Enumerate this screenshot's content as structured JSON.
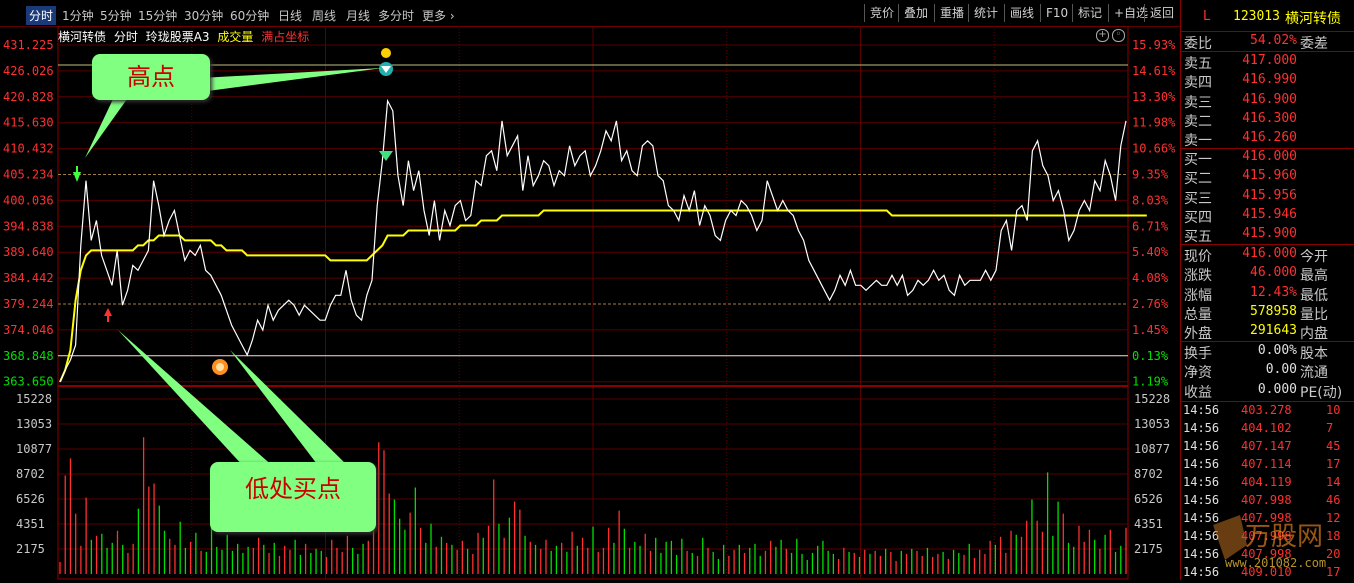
{
  "toolbar": {
    "tabs": [
      "分时",
      "1分钟",
      "5分钟",
      "15分钟",
      "30分钟",
      "60分钟",
      "日线",
      "周线",
      "月线",
      "多分时",
      "更多"
    ],
    "buttons": [
      "竞价",
      "叠加",
      "重播",
      "统计",
      "画线",
      "F10",
      "标记",
      "+自选",
      "返回"
    ]
  },
  "chart": {
    "name": "横河转债",
    "mode": "分时",
    "indicator": "玲珑股票A3",
    "volume_label": "成交量",
    "coord_label": "满占坐标"
  },
  "colors": {
    "up": "#ff3030",
    "down": "#00e000",
    "price_line": "#ffffff",
    "avg_line": "#ffff00",
    "grid": "#5a0000"
  },
  "chart_data": {
    "type": "line",
    "prev_close": 368.848,
    "price_ticks": [
      431.225,
      426.026,
      420.828,
      415.63,
      410.432,
      405.234,
      400.036,
      394.838,
      389.64,
      384.442,
      379.244,
      374.046,
      368.848,
      363.65
    ],
    "pct_ticks": [
      "15.93%",
      "14.61%",
      "13.30%",
      "11.98%",
      "10.66%",
      "9.35%",
      "8.03%",
      "6.71%",
      "5.40%",
      "4.08%",
      "2.76%",
      "1.45%",
      "0.13%",
      "1.19%"
    ],
    "volume_ticks": [
      15228,
      13053,
      10877,
      8702,
      6526,
      4351,
      2175
    ],
    "price": [
      363.6,
      366,
      368,
      371,
      391,
      404,
      392,
      396,
      389,
      386,
      383,
      390,
      379,
      382,
      387,
      386,
      388,
      390,
      404,
      399,
      393,
      396,
      398,
      393,
      388,
      390,
      389,
      391,
      386,
      385,
      383,
      381,
      378,
      375,
      373,
      371,
      369,
      372,
      376,
      374,
      379,
      376,
      378,
      379,
      380,
      379,
      377,
      379,
      378,
      377,
      376,
      376,
      379,
      381,
      381,
      386,
      380,
      377,
      376,
      381,
      384,
      399,
      408,
      420,
      418,
      405,
      399,
      408,
      402,
      406,
      398,
      393,
      400,
      392,
      398,
      395,
      399,
      400,
      396,
      397,
      404,
      403,
      409,
      410,
      406,
      416,
      409,
      411,
      413,
      402,
      409,
      403,
      405,
      408,
      407,
      403,
      406,
      405,
      411,
      407,
      409,
      410,
      405,
      407,
      410,
      414,
      412,
      416,
      408,
      410,
      406,
      405,
      411,
      412,
      411,
      405,
      404,
      399,
      398,
      396,
      401,
      398,
      402,
      395,
      399,
      397,
      393,
      392,
      396,
      398,
      397,
      400,
      399,
      397,
      394,
      396,
      404,
      401,
      398,
      400,
      398,
      397,
      394,
      392,
      388,
      386,
      384,
      382,
      380,
      382,
      385,
      383,
      386,
      383,
      383,
      382,
      383,
      384,
      383,
      383,
      385,
      383,
      385,
      381,
      382,
      384,
      383,
      384,
      386,
      384,
      385,
      382,
      381,
      385,
      383,
      384,
      384,
      384,
      386,
      384,
      386,
      394,
      396,
      390,
      398,
      399,
      396,
      410,
      412,
      407,
      405,
      400,
      402,
      398,
      392,
      394,
      398,
      400,
      398,
      404,
      402,
      408,
      405,
      400,
      411,
      416
    ],
    "avg": [
      363.6,
      366,
      370,
      380,
      386,
      389,
      390,
      390,
      390,
      390,
      390,
      390,
      390,
      390,
      390,
      391,
      391,
      392,
      392,
      393,
      393,
      393,
      393,
      393,
      392,
      392,
      392,
      392,
      392,
      392,
      391,
      391,
      390,
      390,
      390,
      390,
      389,
      389,
      389,
      389,
      389,
      389,
      389,
      389,
      389,
      389,
      389,
      389,
      389,
      389,
      389,
      389,
      388,
      388,
      388,
      388,
      388,
      388,
      388,
      388,
      389,
      390,
      391,
      393,
      393,
      393,
      393,
      394,
      394,
      394,
      394,
      394,
      394,
      394,
      394,
      394,
      394,
      395,
      395,
      395,
      395,
      396,
      396,
      396,
      396,
      397,
      397,
      397,
      397,
      397,
      397,
      397,
      397,
      398,
      398,
      398,
      398,
      398,
      398,
      398,
      398,
      398,
      398,
      398,
      398,
      398,
      398,
      398,
      398,
      398,
      398,
      398,
      398,
      398,
      398,
      398,
      398,
      398,
      398,
      398,
      398,
      398,
      398,
      398,
      398,
      398,
      398,
      398,
      398,
      398,
      398,
      398,
      398,
      398,
      398,
      398,
      398,
      398,
      398,
      398,
      398,
      398,
      398,
      398,
      398,
      398,
      398,
      398,
      398,
      398,
      398,
      398,
      398,
      398,
      398,
      398,
      398,
      398,
      398,
      398,
      397,
      397,
      397,
      397,
      397,
      397,
      397,
      397,
      397,
      397,
      397,
      397,
      397,
      397,
      397,
      397,
      397,
      397,
      397,
      397,
      397,
      397,
      397,
      397,
      397,
      397,
      397,
      397,
      397,
      397,
      397,
      397,
      397,
      397,
      397,
      397,
      397,
      397,
      397,
      397,
      397,
      397,
      397,
      397,
      397,
      397,
      397,
      397,
      397,
      397
    ],
    "volume": [
      1200,
      9800,
      11500,
      6000,
      2800,
      7600,
      3400,
      3800,
      4000,
      2600,
      3100,
      4300,
      2900,
      2100,
      3000,
      6500,
      13600,
      8700,
      9000,
      6800,
      4300,
      3500,
      2900,
      5200,
      2600,
      3200,
      4100,
      2300,
      2200,
      5400,
      2700,
      2400,
      3900,
      2300,
      3000,
      2100,
      2700,
      2600,
      3600,
      2900,
      2100,
      3100,
      1800,
      2800,
      2400,
      3400,
      1900,
      3000,
      2100,
      2500,
      2300,
      1700,
      3400,
      2600,
      2200,
      3800,
      2600,
      2000,
      3000,
      3300,
      7300,
      13100,
      12300,
      8000,
      7400,
      5500,
      4400,
      6100,
      8600,
      4600,
      3100,
      5000,
      2700,
      3700,
      3100,
      2900,
      2400,
      3300,
      2500,
      2000,
      4100,
      3600,
      4800,
      9400,
      5000,
      3600,
      5600,
      7200,
      6400,
      3800,
      3200,
      2900,
      2500,
      3400,
      2300,
      2800,
      3100,
      2200,
      4200,
      2800,
      3600,
      2600,
      4700,
      2200,
      2600,
      4600,
      3100,
      6300,
      4500,
      2600,
      3200,
      2800,
      4000,
      2300,
      3600,
      2100,
      3200,
      3300,
      1900,
      3500,
      2300,
      2100,
      1800,
      3600,
      2600,
      2200,
      1500,
      2900,
      1800,
      2400,
      2900,
      2100,
      2600,
      3000,
      1800,
      2300,
      3300,
      2700,
      3400,
      2500,
      2100,
      3500,
      2000,
      1400,
      2100,
      2800,
      3300,
      2300,
      2000,
      1500,
      2600,
      2200,
      2100,
      1700,
      2400,
      2000,
      2300,
      1800,
      2500,
      2200,
      1300,
      2300,
      2000,
      2500,
      2300,
      1800,
      2600,
      1700,
      2000,
      2200,
      1500,
      2400,
      2100,
      1900,
      3000,
      1600,
      2400,
      2000,
      3300,
      2900,
      3700,
      2100,
      4300,
      3900,
      3700,
      5300,
      7400,
      5300,
      4200,
      10100,
      3800,
      7200,
      6000,
      3100,
      2700,
      4800,
      3200,
      4400,
      3400,
      2500,
      3900,
      4400,
      2200,
      2800,
      4600
    ]
  },
  "annotations": {
    "high": "高点",
    "low_buy": "低处买点"
  },
  "panel": {
    "code_prefix": "L",
    "code": "123013",
    "name": "横河转债",
    "weibi": {
      "label": "委比",
      "value": "54.02%",
      "label2": "委差"
    },
    "asks": [
      {
        "label": "卖五",
        "value": "417.000"
      },
      {
        "label": "卖四",
        "value": "416.990"
      },
      {
        "label": "卖三",
        "value": "416.900"
      },
      {
        "label": "卖二",
        "value": "416.300"
      },
      {
        "label": "卖一",
        "value": "416.260"
      }
    ],
    "bids": [
      {
        "label": "买一",
        "value": "416.000"
      },
      {
        "label": "买二",
        "value": "415.960"
      },
      {
        "label": "买三",
        "value": "415.956"
      },
      {
        "label": "买四",
        "value": "415.946"
      },
      {
        "label": "买五",
        "value": "415.900"
      }
    ],
    "stats": [
      {
        "label": "现价",
        "value": "416.000",
        "label2": "今开"
      },
      {
        "label": "涨跌",
        "value": "46.000",
        "label2": "最高"
      },
      {
        "label": "涨幅",
        "value": "12.43%",
        "label2": "最低"
      },
      {
        "label": "总量",
        "value": "578958",
        "label2": "量比"
      },
      {
        "label": "外盘",
        "value": "291643",
        "label2": "内盘"
      }
    ],
    "extra": [
      {
        "label": "换手",
        "value": "0.00%",
        "label2": "股本"
      },
      {
        "label": "净资",
        "value": "0.00",
        "label2": "流通"
      },
      {
        "label": "收益",
        "value": "0.000",
        "label2": "PE(动)"
      }
    ],
    "ticks": [
      {
        "time": "14:56",
        "price": "403.278",
        "vol": "10"
      },
      {
        "time": "14:56",
        "price": "404.102",
        "vol": "7"
      },
      {
        "time": "14:56",
        "price": "407.147",
        "vol": "45"
      },
      {
        "time": "14:56",
        "price": "407.114",
        "vol": "17"
      },
      {
        "time": "14:56",
        "price": "404.119",
        "vol": "14"
      },
      {
        "time": "14:56",
        "price": "407.998",
        "vol": "46"
      },
      {
        "time": "14:56",
        "price": "407.998",
        "vol": "12"
      },
      {
        "time": "14:56",
        "price": "407.998",
        "vol": "18"
      },
      {
        "time": "14:56",
        "price": "407.998",
        "vol": "20"
      },
      {
        "time": "14:56",
        "price": "409.010",
        "vol": "17"
      }
    ]
  },
  "watermark": {
    "text": "万股网",
    "url": "www.201082.com"
  }
}
